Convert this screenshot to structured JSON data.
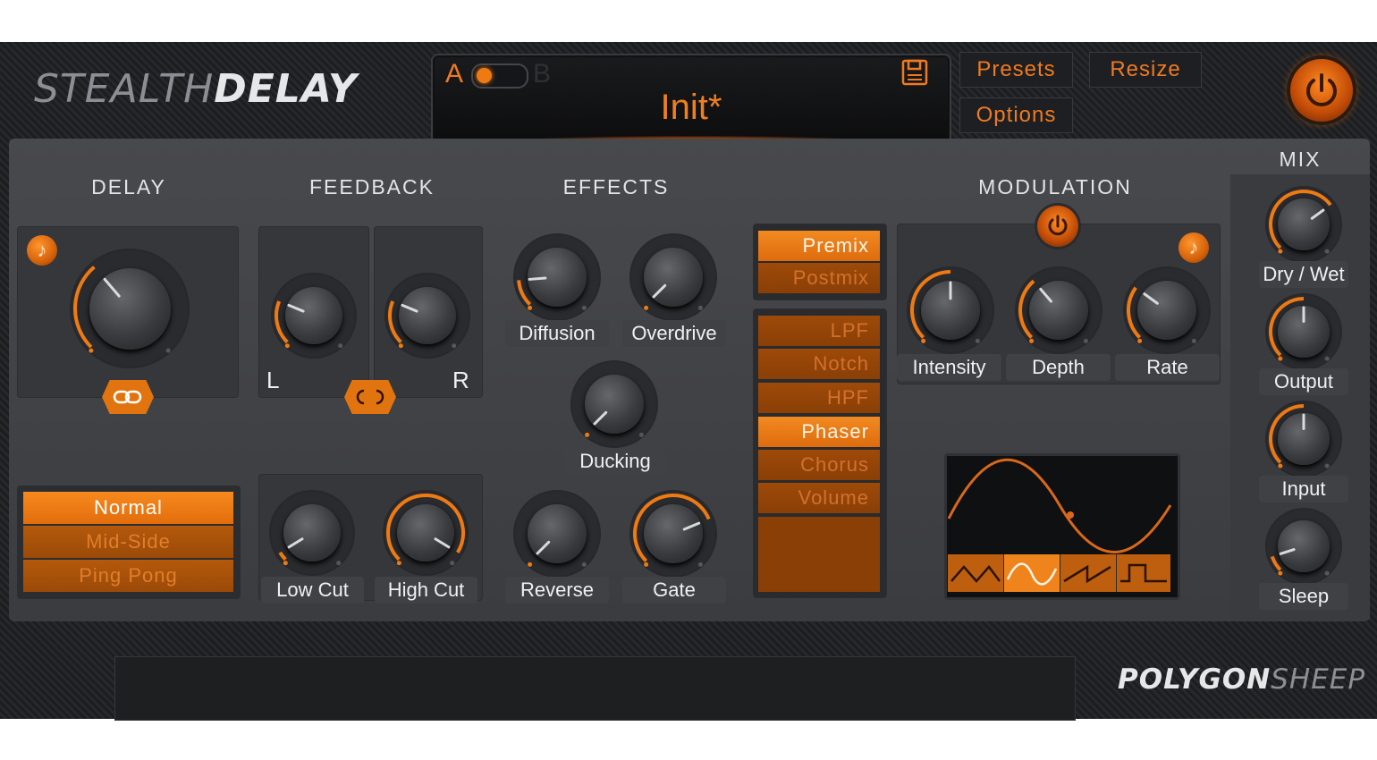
{
  "header": {
    "brand_light": "STEALTH",
    "brand_bold": "DELAY",
    "ab_a": "A",
    "ab_b": "B",
    "preset_name": "Init*",
    "presets_label": "Presets",
    "resize_label": "Resize",
    "options_label": "Options"
  },
  "sections": {
    "delay": "DELAY",
    "feedback": "FEEDBACK",
    "effects": "EFFECTS",
    "modulation": "MODULATION",
    "mix": "MIX"
  },
  "feedback": {
    "left": "L",
    "right": "R"
  },
  "delay_modes": [
    "Normal",
    "Mid-Side",
    "Ping Pong"
  ],
  "delay_mode_selected": "Normal",
  "fx_routing": [
    "Premix",
    "Postmix"
  ],
  "fx_routing_selected": "Premix",
  "fx_types": [
    "LPF",
    "Notch",
    "HPF",
    "Phaser",
    "Chorus",
    "Volume"
  ],
  "fx_type_selected": "Phaser",
  "knobs": {
    "diffusion": "Diffusion",
    "overdrive": "Overdrive",
    "ducking": "Ducking",
    "reverse": "Reverse",
    "gate": "Gate",
    "low_cut": "Low Cut",
    "high_cut": "High Cut",
    "intensity": "Intensity",
    "depth": "Depth",
    "rate": "Rate",
    "dry_wet": "Dry / Wet",
    "output": "Output",
    "input": "Input",
    "sleep": "Sleep"
  },
  "lfo_shapes": [
    "triangle",
    "sine",
    "saw",
    "square"
  ],
  "lfo_shape_selected": "sine",
  "footer": {
    "brand_bold": "POLYGON",
    "brand_light": "SHEEP"
  },
  "colors": {
    "accent": "#f07a12",
    "panel": "#434448",
    "text": "#eef0f2"
  }
}
